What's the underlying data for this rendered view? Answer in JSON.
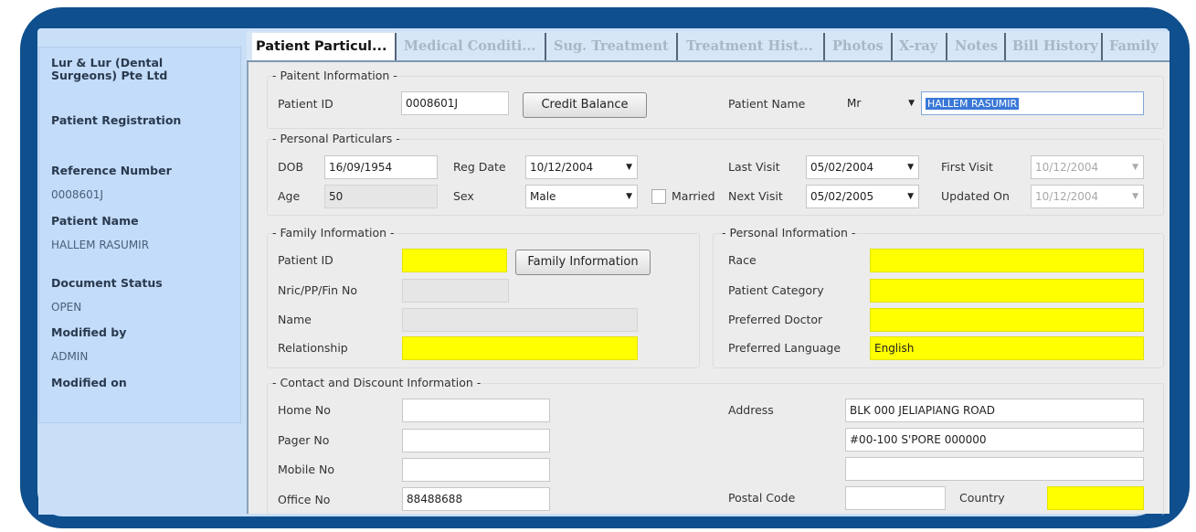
{
  "sidebar": {
    "company": "Lur & Lur (Dental Surgeons) Pte Ltd",
    "screen": "Patient Registration",
    "ref_label": "Reference Number",
    "ref_value": "0008601J",
    "name_label": "Patient Name",
    "name_value": "HALLEM RASUMIR",
    "status_label": "Document Status",
    "status_value": "OPEN",
    "modby_label": "Modified by",
    "modby_value": "ADMIN",
    "modon_label": "Modified on"
  },
  "tabs": [
    "Patient Particul...",
    "Medical Conditi...",
    "Sug. Treatment",
    "Treatment Hist...",
    "Photos",
    "X-ray",
    "Notes",
    "Bill History",
    "Family"
  ],
  "patient_info": {
    "legend": "- Paitent Information -",
    "id_label": "Patient ID",
    "id_value": "0008601J",
    "credit_button": "Credit Balance",
    "name_label": "Patient Name",
    "title_value": "Mr",
    "name_value": "HALLEM RASUMIR"
  },
  "personal_particulars": {
    "legend": "- Personal Particulars -",
    "dob_label": "DOB",
    "dob_value": "16/09/1954",
    "age_label": "Age",
    "age_value": "50",
    "regdate_label": "Reg Date",
    "regdate_value": "10/12/2004",
    "sex_label": "Sex",
    "sex_value": "Male",
    "married_label": "Married",
    "lastvisit_label": "Last Visit",
    "lastvisit_value": "05/02/2004",
    "nextvisit_label": "Next Visit",
    "nextvisit_value": "05/02/2005",
    "firstvisit_label": "First Visit",
    "firstvisit_value": "10/12/2004",
    "updated_label": "Updated On",
    "updated_value": "10/12/2004"
  },
  "family_info": {
    "legend": "- Family Information -",
    "id_label": "Patient ID",
    "family_button": "Family Information",
    "nric_label": "Nric/PP/Fin No",
    "name_label": "Name",
    "relationship_label": "Relationship"
  },
  "personal_info": {
    "legend": "- Personal Information -",
    "race_label": "Race",
    "category_label": "Patient Category",
    "doctor_label": "Preferred Doctor",
    "language_label": "Preferred Language",
    "language_value": "English"
  },
  "contact": {
    "legend": "- Contact and Discount Information -",
    "home_label": "Home No",
    "pager_label": "Pager No",
    "mobile_label": "Mobile No",
    "office_label": "Office No",
    "office_value": "88488688",
    "address_label": "Address",
    "address_line1": "BLK 000 JELIAPIANG ROAD",
    "address_line2": "#00-100 S'PORE 000000",
    "postal_label": "Postal Code",
    "country_label": "Country"
  },
  "colors": {
    "frame": "#0f4f8e",
    "panel": "#c3dcf9",
    "required_field": "#ffff00",
    "selection": "#3a78d8"
  }
}
